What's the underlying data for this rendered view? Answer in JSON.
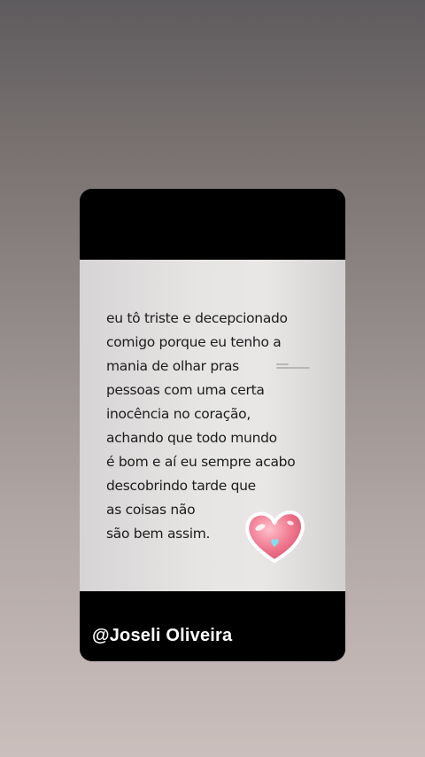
{
  "post": {
    "quote_lines": [
      "eu tô triste e decepcionado",
      "comigo porque eu tenho a",
      "mania de olhar pras",
      "pessoas com uma certa",
      "inocência no coração,",
      "achando que todo mundo",
      "é bom e aí eu sempre acabo",
      "descobrindo tarde que",
      "as coisas não",
      "são bem assim."
    ],
    "sticker": "heart-sticker",
    "author_handle": "@Joseli Oliveira"
  },
  "colors": {
    "background_top": "#5e5b5e",
    "background_bottom": "#cbbfbc",
    "card_frame": "#000000",
    "paper": "#e6e5e4",
    "text": "#1c1c1c",
    "heart": "#f07a90",
    "handle_text": "#ffffff"
  }
}
